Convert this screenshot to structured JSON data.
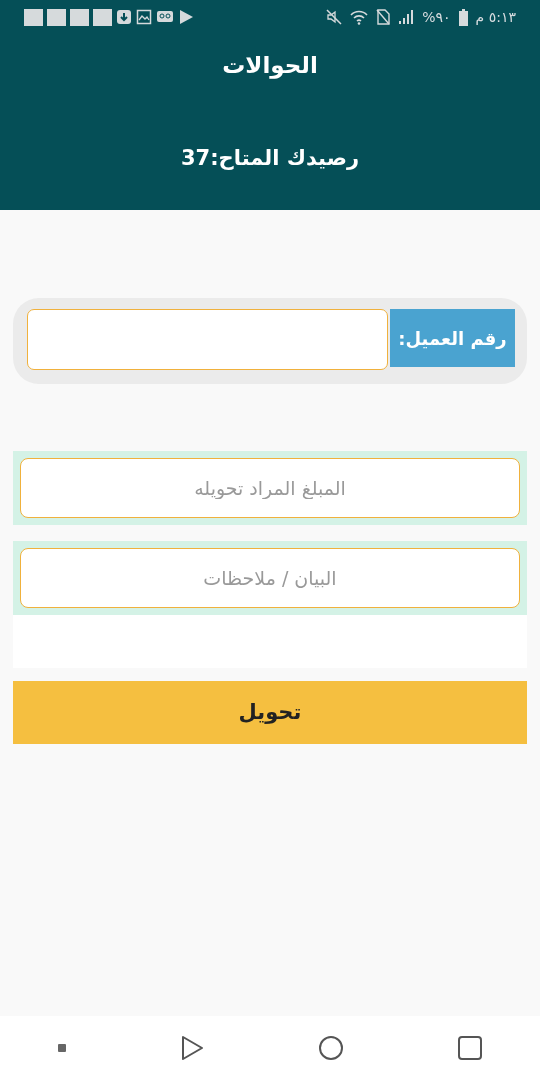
{
  "status_bar": {
    "time": "٥:١٣ م",
    "battery": "%٩٠"
  },
  "header": {
    "title": "الحوالات",
    "balance": "رصيدك المتاح:37"
  },
  "customer": {
    "label": "رقم العميل:"
  },
  "fields": [
    {
      "placeholder": "المبلغ المراد تحويله"
    },
    {
      "placeholder": "البيان / ملاحظات"
    }
  ],
  "submit": "تحويل"
}
